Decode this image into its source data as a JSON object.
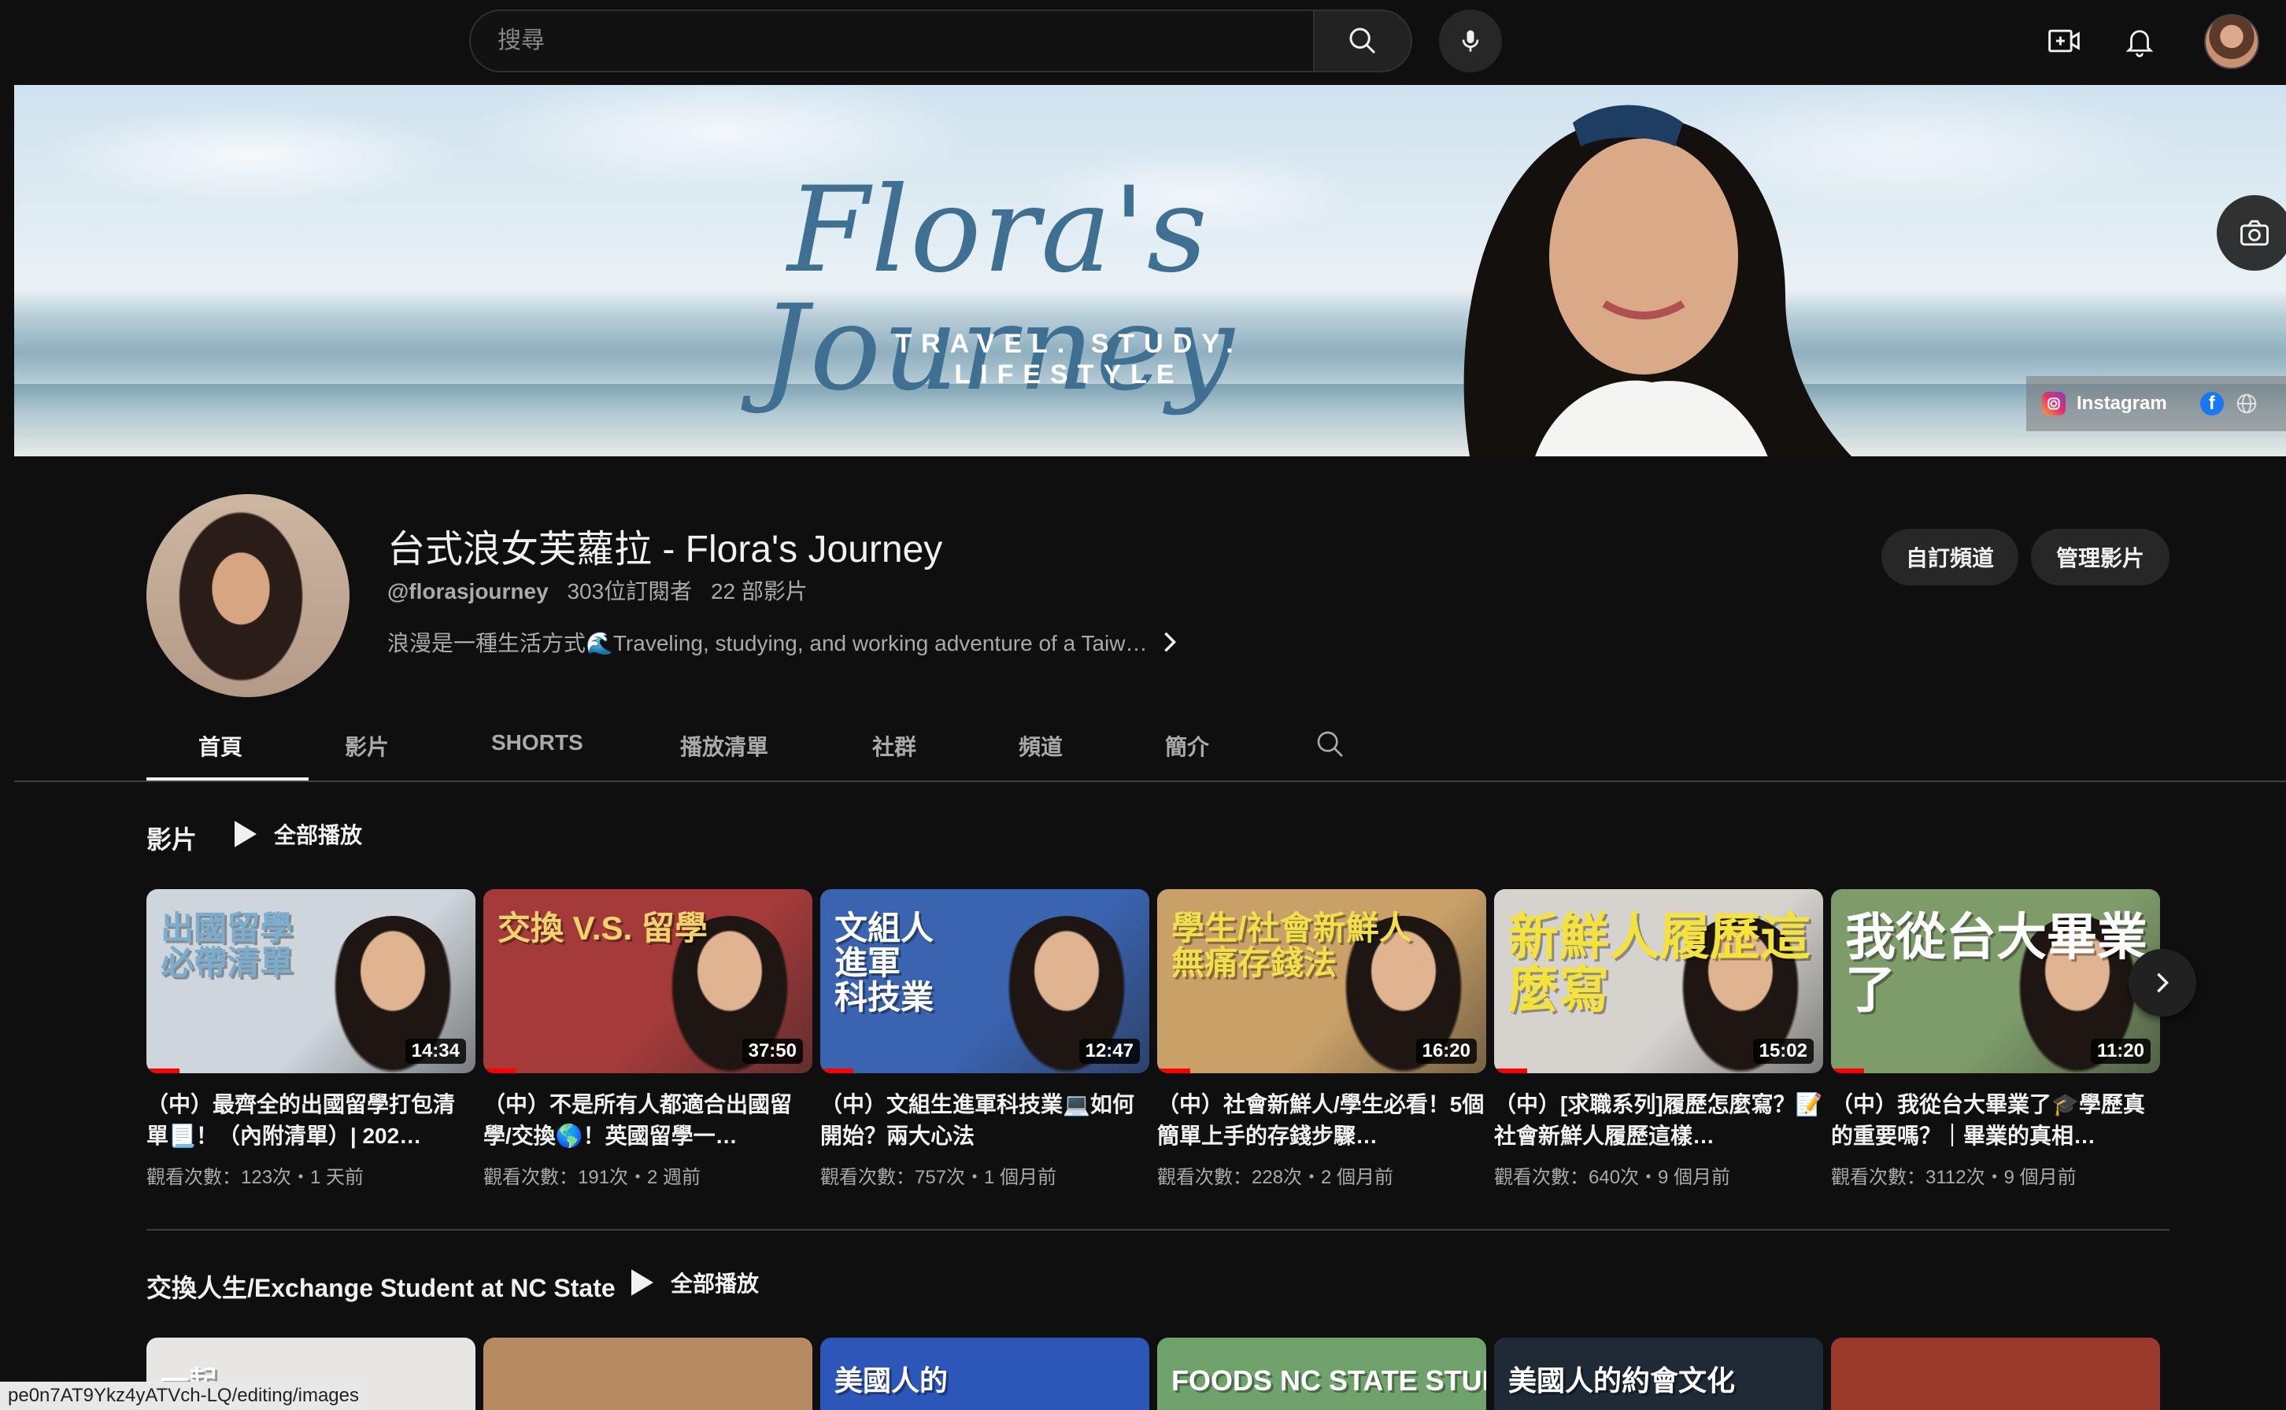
{
  "topbar": {
    "search_placeholder": "搜尋",
    "icons": [
      "search-icon",
      "mic-icon",
      "create-icon",
      "bell-icon",
      "avatar"
    ]
  },
  "banner": {
    "title": "Flora's Journey",
    "tagline": "TRAVEL. STUDY. LIFESTYLE",
    "links": {
      "instagram_label": "Instagram"
    }
  },
  "channel": {
    "name": "台式浪女芙蘿拉 - Flora's Journey",
    "handle": "@florasjourney",
    "subscribers": "303位訂閱者",
    "video_count": "22 部影片",
    "description": "浪漫是一種生活方式🌊Traveling, studying, and working adventure of a Taiw…",
    "customize_button": "自訂頻道",
    "manage_button": "管理影片"
  },
  "tabs": [
    "首頁",
    "影片",
    "SHORTS",
    "播放清單",
    "社群",
    "頻道",
    "簡介"
  ],
  "shelf1": {
    "title": "影片",
    "play_all": "全部播放",
    "videos": [
      {
        "thumb_text": "出國留學\n必帶清單",
        "duration": "14:34",
        "title": "（中）最齊全的出國留學打包清單📃！（內附清單）| 202…",
        "meta": "觀看次數：123次・1 天前",
        "bg": "#cfd6db",
        "accent": "#7aaed0",
        "progress": 0.1
      },
      {
        "thumb_text": "交換 V.S. 留學",
        "duration": "37:50",
        "title": "（中）不是所有人都適合出國留學/交換🌎！英國留學一…",
        "meta": "觀看次數：191次・2 週前",
        "bg": "#a43a3a",
        "accent": "#f1d36b",
        "progress": 0.1
      },
      {
        "thumb_text": "文組人\n進軍\n科技業",
        "duration": "12:47",
        "title": "（中）文組生進軍科技業💻如何開始？兩大心法",
        "meta": "觀看次數：757次・1 個月前",
        "bg": "#3a63b0",
        "accent": "#ffffff",
        "progress": 0.1
      },
      {
        "thumb_text": "學生/社會新鮮人\n無痛存錢法",
        "duration": "16:20",
        "title": "（中）社會新鮮人/學生必看！5個簡單上手的存錢步驟…",
        "meta": "觀看次數：228次・2 個月前",
        "bg": "#c9a067",
        "accent": "#f2e04a",
        "progress": 0.1
      },
      {
        "thumb_text": "新鮮人履歷這麼寫",
        "duration": "15:02",
        "title": "（中）[求職系列]履歷怎麼寫？📝社會新鮮人履歷這樣…",
        "meta": "觀看次數：640次・9 個月前",
        "bg": "#d6d3cf",
        "accent": "#f5e23a",
        "progress": 0.1
      },
      {
        "thumb_text": "我從台大畢業了",
        "duration": "11:20",
        "title": "（中）我從台大畢業了🎓學歷真的重要嗎？｜畢業的真相…",
        "meta": "觀看次數：3112次・9 個月前",
        "bg": "#7e9c6a",
        "accent": "#ffffff",
        "progress": 0.1
      }
    ]
  },
  "shelf2": {
    "title": "交換人生/Exchange Student at NC State",
    "play_all": "全部播放",
    "thumbs": [
      {
        "text": "一起",
        "bg": "#e8e6e3"
      },
      {
        "text": "",
        "bg": "#b78a62"
      },
      {
        "text": "美國人的",
        "bg": "#2c57b8"
      },
      {
        "text": "FOODS NC STATE STUDENTS EAT",
        "bg": "#6fa36b"
      },
      {
        "text": "美國人的約會文化",
        "bg": "#1f2a36"
      },
      {
        "text": "",
        "bg": "#9a3a2a"
      }
    ]
  },
  "status_url": "pe0n7AT9Ykz4yATVch-LQ/editing/images"
}
